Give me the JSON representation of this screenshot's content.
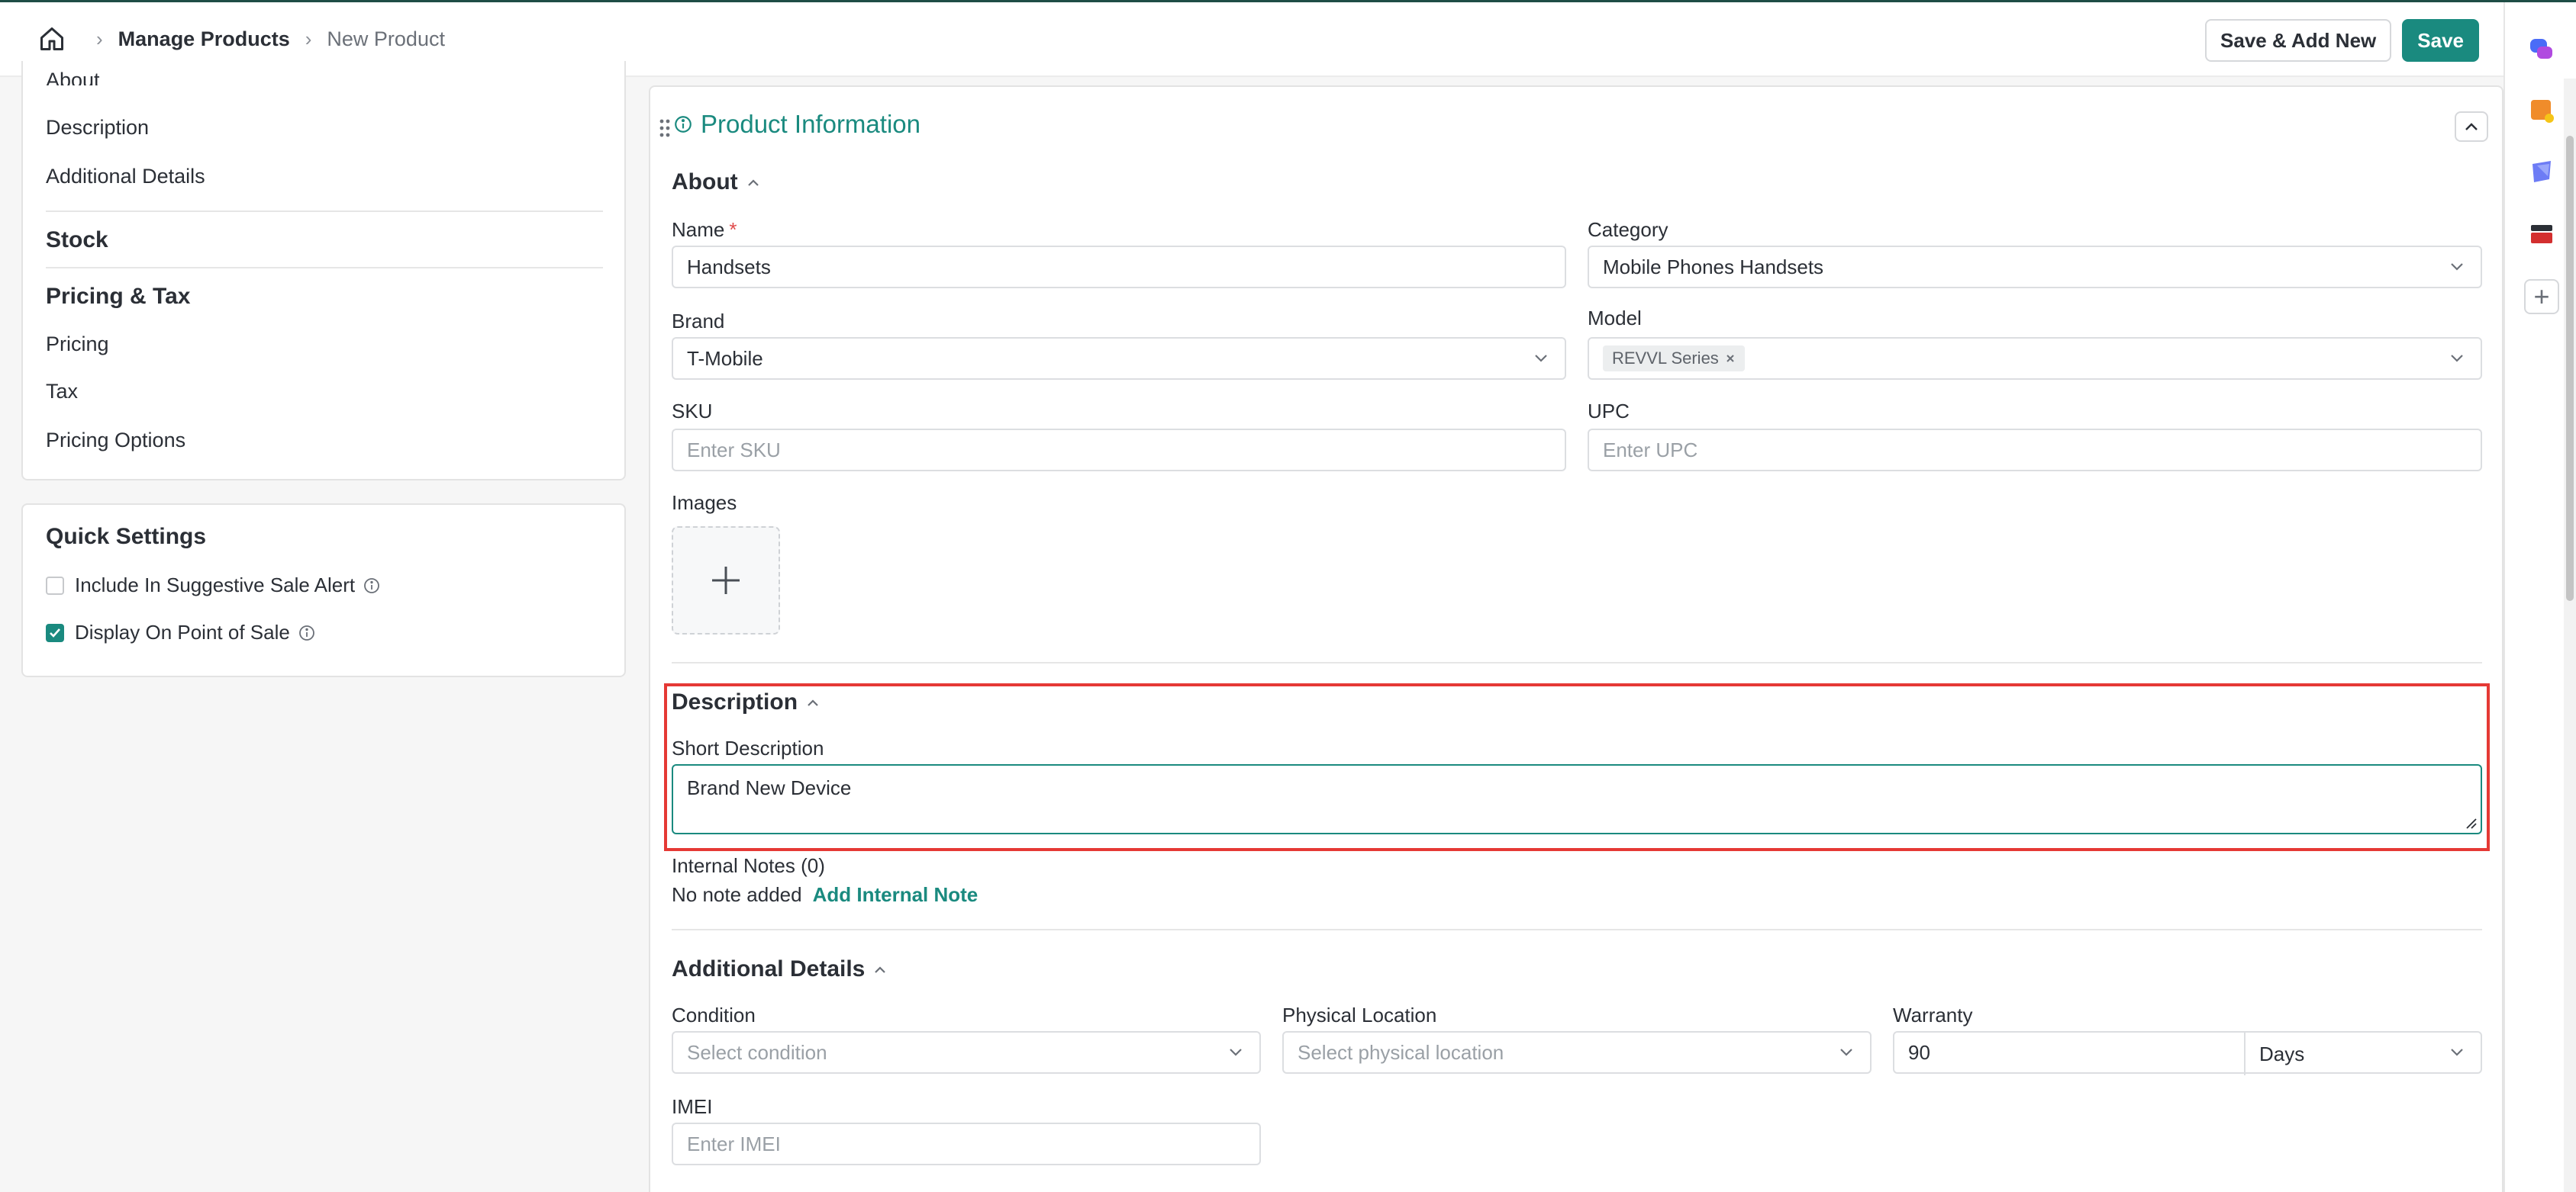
{
  "header": {
    "breadcrumb": {
      "home_icon": "home-icon",
      "parent": "Manage Products",
      "current": "New Product"
    },
    "save_add_new_label": "Save & Add New",
    "save_label": "Save"
  },
  "sidebar": {
    "about_partial": "About",
    "description": "Description",
    "additional_details": "Additional Details",
    "stock": "Stock",
    "pricing_tax": "Pricing & Tax",
    "pricing": "Pricing",
    "tax": "Tax",
    "pricing_options": "Pricing Options"
  },
  "quick_settings": {
    "title": "Quick Settings",
    "items": [
      {
        "label": "Include In Suggestive Sale Alert",
        "checked": false
      },
      {
        "label": "Display On Point of Sale",
        "checked": true
      }
    ]
  },
  "product_info": {
    "title": "Product Information",
    "about": {
      "title": "About",
      "name_label": "Name",
      "required_mark": "*",
      "name_value": "Handsets",
      "category_label": "Category",
      "category_value": "Mobile Phones Handsets",
      "brand_label": "Brand",
      "brand_value": "T-Mobile",
      "model_label": "Model",
      "model_tag": "REVVL Series",
      "sku_label": "SKU",
      "sku_placeholder": "Enter SKU",
      "upc_label": "UPC",
      "upc_placeholder": "Enter UPC",
      "images_label": "Images"
    },
    "description": {
      "title": "Description",
      "short_label": "Short Description",
      "short_value": "Brand New Device",
      "notes_label": "Internal Notes (0)",
      "no_note": "No note added",
      "add_note": "Add Internal Note"
    },
    "additional": {
      "title": "Additional Details",
      "condition_label": "Condition",
      "condition_placeholder": "Select condition",
      "location_label": "Physical Location",
      "location_placeholder": "Select physical location",
      "warranty_label": "Warranty",
      "warranty_value": "90",
      "warranty_unit": "Days",
      "imei_label": "IMEI",
      "imei_placeholder": "Enter IMEI"
    }
  },
  "colors": {
    "accent": "#1a8a7f",
    "highlight": "#e53935",
    "required": "#e04b4b"
  }
}
